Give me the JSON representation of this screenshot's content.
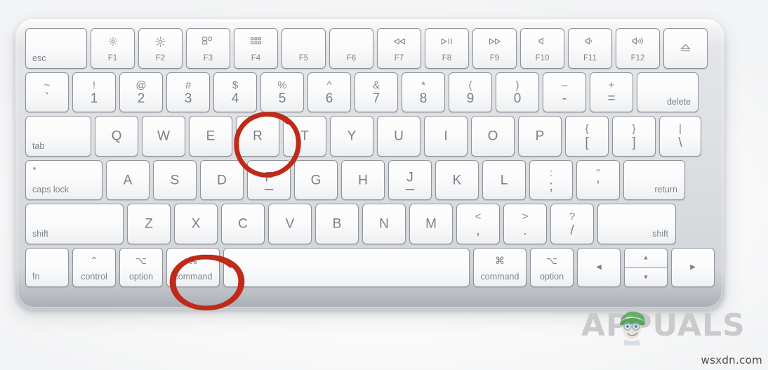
{
  "image": {
    "subject": "Apple Magic Keyboard (US layout)",
    "watermark_text": "APPUALS",
    "site_credit": "wsxdn.com",
    "annotation_color": "#bf2a19",
    "key_text_color": "#7b8087",
    "body_color": "#dcdee2"
  },
  "annotations": [
    {
      "name": "circle-r",
      "target": "R key",
      "shape": "hand-drawn-circle"
    },
    {
      "name": "circle-command",
      "target": "command key (left)",
      "shape": "hand-drawn-circle"
    }
  ],
  "keyboard": {
    "function_row": [
      {
        "id": "esc",
        "bl": "esc"
      },
      {
        "id": "f1",
        "glyph": "brightness-low-icon",
        "fnum": "F1"
      },
      {
        "id": "f2",
        "glyph": "brightness-high-icon",
        "fnum": "F2"
      },
      {
        "id": "f3",
        "glyph": "mission-control-icon",
        "fnum": "F3"
      },
      {
        "id": "f4",
        "glyph": "launchpad-icon",
        "fnum": "F4"
      },
      {
        "id": "f5",
        "glyph": "",
        "fnum": "F5"
      },
      {
        "id": "f6",
        "glyph": "",
        "fnum": "F6"
      },
      {
        "id": "f7",
        "glyph": "rewind-icon",
        "fnum": "F7"
      },
      {
        "id": "f8",
        "glyph": "play-pause-icon",
        "fnum": "F8"
      },
      {
        "id": "f9",
        "glyph": "fast-forward-icon",
        "fnum": "F9"
      },
      {
        "id": "f10",
        "glyph": "mute-icon",
        "fnum": "F10"
      },
      {
        "id": "f11",
        "glyph": "volume-down-icon",
        "fnum": "F11"
      },
      {
        "id": "f12",
        "glyph": "volume-up-icon",
        "fnum": "F12"
      },
      {
        "id": "eject",
        "glyph": "eject-icon",
        "fnum": ""
      }
    ],
    "number_row": [
      {
        "id": "backtick",
        "upper": "~",
        "lower": "`"
      },
      {
        "id": "1",
        "upper": "!",
        "lower": "1"
      },
      {
        "id": "2",
        "upper": "@",
        "lower": "2"
      },
      {
        "id": "3",
        "upper": "#",
        "lower": "3"
      },
      {
        "id": "4",
        "upper": "$",
        "lower": "4"
      },
      {
        "id": "5",
        "upper": "%",
        "lower": "5"
      },
      {
        "id": "6",
        "upper": "^",
        "lower": "6"
      },
      {
        "id": "7",
        "upper": "&",
        "lower": "7"
      },
      {
        "id": "8",
        "upper": "*",
        "lower": "8"
      },
      {
        "id": "9",
        "upper": "(",
        "lower": "9"
      },
      {
        "id": "0",
        "upper": ")",
        "lower": "0"
      },
      {
        "id": "minus",
        "upper": "–",
        "lower": "-"
      },
      {
        "id": "equals",
        "upper": "+",
        "lower": "="
      },
      {
        "id": "delete",
        "br": "delete"
      }
    ],
    "q_row": [
      {
        "id": "tab",
        "bl": "tab"
      },
      {
        "id": "q",
        "center": "Q"
      },
      {
        "id": "w",
        "center": "W"
      },
      {
        "id": "e",
        "center": "E"
      },
      {
        "id": "r",
        "center": "R"
      },
      {
        "id": "t",
        "center": "T"
      },
      {
        "id": "y",
        "center": "Y"
      },
      {
        "id": "u",
        "center": "U"
      },
      {
        "id": "i",
        "center": "I"
      },
      {
        "id": "o",
        "center": "O"
      },
      {
        "id": "p",
        "center": "P"
      },
      {
        "id": "lbracket",
        "upper": "{",
        "lower": "["
      },
      {
        "id": "rbracket",
        "upper": "}",
        "lower": "]"
      },
      {
        "id": "backslash",
        "upper": "|",
        "lower": "\\"
      }
    ],
    "a_row": [
      {
        "id": "capslock",
        "bl": "caps lock"
      },
      {
        "id": "a",
        "center": "A"
      },
      {
        "id": "s",
        "center": "S"
      },
      {
        "id": "d",
        "center": "D"
      },
      {
        "id": "f",
        "center": "F",
        "homing": true
      },
      {
        "id": "g",
        "center": "G"
      },
      {
        "id": "h",
        "center": "H"
      },
      {
        "id": "j",
        "center": "J",
        "homing": true
      },
      {
        "id": "k",
        "center": "K"
      },
      {
        "id": "l",
        "center": "L"
      },
      {
        "id": "semicolon",
        "upper": ":",
        "lower": ";"
      },
      {
        "id": "quote",
        "upper": "”",
        "lower": "’"
      },
      {
        "id": "return",
        "br": "return"
      }
    ],
    "z_row": [
      {
        "id": "shift-left",
        "bl": "shift"
      },
      {
        "id": "z",
        "center": "Z"
      },
      {
        "id": "x",
        "center": "X"
      },
      {
        "id": "c",
        "center": "C"
      },
      {
        "id": "v",
        "center": "V"
      },
      {
        "id": "b",
        "center": "B"
      },
      {
        "id": "n",
        "center": "N"
      },
      {
        "id": "m",
        "center": "M"
      },
      {
        "id": "comma",
        "upper": "<",
        "lower": ","
      },
      {
        "id": "period",
        "upper": ">",
        "lower": "."
      },
      {
        "id": "slash",
        "upper": "?",
        "lower": "/"
      },
      {
        "id": "shift-right",
        "br": "shift"
      }
    ],
    "space_row": [
      {
        "id": "fn",
        "bl": "fn"
      },
      {
        "id": "control-left",
        "sym": "⌃",
        "word": "control"
      },
      {
        "id": "option-left",
        "sym": "⌥",
        "word": "option"
      },
      {
        "id": "command-left",
        "sym": "⌘",
        "word": "command"
      },
      {
        "id": "space",
        "word": ""
      },
      {
        "id": "command-right",
        "sym": "⌘",
        "word": "command"
      },
      {
        "id": "option-right",
        "sym": "⌥",
        "word": "option"
      },
      {
        "id": "arrow-left",
        "glyph": "arrow-left-icon"
      },
      {
        "id": "arrow-updown",
        "glyph": "arrow-up-down-icon"
      },
      {
        "id": "arrow-right",
        "glyph": "arrow-right-icon"
      }
    ]
  }
}
